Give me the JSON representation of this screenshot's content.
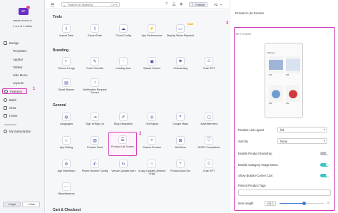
{
  "app": {
    "logo_text": "FF",
    "name": "aaaaa.mmmm.io",
    "task_progress": "1 out of 4 tasks"
  },
  "sidebar": {
    "items": [
      {
        "label": "Design",
        "icon": "pen-icon"
      },
      {
        "label": "Templates",
        "icon": ""
      },
      {
        "label": "AppBar",
        "icon": ""
      },
      {
        "label": "TabBar",
        "icon": ""
      },
      {
        "label": "Side Menu",
        "icon": ""
      },
      {
        "label": "Layouts",
        "icon": ""
      },
      {
        "label": "Features",
        "icon": "plus-circle-icon"
      },
      {
        "label": "Build",
        "icon": "gear-icon"
      },
      {
        "label": "Chat",
        "icon": "chat-icon"
      },
      {
        "label": "Home",
        "icon": "home-icon"
      }
    ],
    "section_label": "aaaaaaaaa",
    "subscription": "My Subscription",
    "marker": "1",
    "mode": {
      "light": "Light",
      "dark": "Dark"
    }
  },
  "topbar": {
    "search_placeholder": "Search for anything",
    "shortcut": "Ctrl+K",
    "publish": "Publish",
    "version": "V2"
  },
  "main": {
    "sections": [
      {
        "title": "Tools",
        "tiles": [
          {
            "label": "Import Data",
            "icon": "import-icon"
          },
          {
            "label": "Export Data",
            "icon": "export-icon"
          },
          {
            "label": "Cloud Config",
            "icon": "cloud-icon"
          },
          {
            "label": "App Performance",
            "icon": "speed-icon"
          },
          {
            "label": "Display Stripe Payment",
            "icon": "card-icon",
            "badge": "NEW"
          }
        ]
      },
      {
        "title": "Branding",
        "tiles": [
          {
            "label": "Theme & Logo",
            "icon": "palette-icon"
          },
          {
            "label": "Color Override",
            "icon": "brush-icon"
          },
          {
            "label": "Loading Icon",
            "icon": "loader-icon"
          },
          {
            "label": "Splash Screen",
            "icon": "splash-icon"
          },
          {
            "label": "Onboarding",
            "icon": "flag-icon"
          },
          {
            "label": "Chat GPT",
            "icon": "bot-icon"
          },
          {
            "label": "Smart Banner",
            "icon": "banner-icon"
          },
          {
            "label": "Notification Request Screen",
            "icon": "bell-icon"
          }
        ]
      },
      {
        "title": "General",
        "tiles": [
          {
            "label": "Languages",
            "icon": "globe-icon"
          },
          {
            "label": "Sign In/Sign Up",
            "icon": "login-icon"
          },
          {
            "label": "Blog Integration",
            "icon": "blog-icon"
          },
          {
            "label": "OneSignal",
            "icon": "signal-icon"
          },
          {
            "label": "Google Maps",
            "icon": "map-icon"
          },
          {
            "label": "Advertisement",
            "icon": "ad-icon"
          },
          {
            "label": "App Rating",
            "icon": "star-icon"
          },
          {
            "label": "Product Card",
            "icon": "tag-icon"
          },
          {
            "label": "Product List Screen",
            "icon": "list-icon"
          },
          {
            "label": "Search Product",
            "icon": "search-icon"
          },
          {
            "label": "WebView",
            "icon": "web-icon"
          },
          {
            "label": "GDPR Compliance",
            "icon": "shield-icon"
          },
          {
            "label": "Age Restriction",
            "icon": "age-icon"
          },
          {
            "label": "Phone Number Config",
            "icon": "phone-icon"
          },
          {
            "label": "Version Update Alert",
            "icon": "update-icon"
          },
          {
            "label": "In-app Update (Android Only)",
            "icon": "android-icon"
          },
          {
            "label": "Product Add-Ons",
            "icon": "addon-icon"
          },
          {
            "label": "Chat GPT",
            "icon": "bot-icon"
          },
          {
            "label": "Miscellaneous",
            "icon": "misc-icon"
          }
        ]
      },
      {
        "title": "Cart & Checkout",
        "tiles": []
      }
    ],
    "marker": "2"
  },
  "panel": {
    "title": "Product List Screen",
    "marker": "3",
    "settings_label": "SETTINGS",
    "preview": {
      "title": "Women",
      "products": [
        {
          "price": "$29",
          "kind": "dress1"
        },
        {
          "price": "$35",
          "kind": "dress2"
        },
        {
          "price": "$48",
          "kind": "bag1"
        },
        {
          "price": "$52",
          "kind": "bag2"
        }
      ]
    },
    "fields": {
      "layout_label": "Product List Layout",
      "layout_value": "list",
      "sort_label": "Sort By",
      "sort_value": "None",
      "backdrop_label": "Enable Product Backdrop",
      "backdrop_on": false,
      "category_label": "Enable Category Image Menu",
      "category_on": true,
      "cart_label": "Show Bottom-Corner Cart",
      "cart_on": true,
      "tags_label": "Pinned Product Tags",
      "item_height_label": "Item Height",
      "item_height_value": "125.0",
      "item_height_fraction": 0.55
    }
  }
}
